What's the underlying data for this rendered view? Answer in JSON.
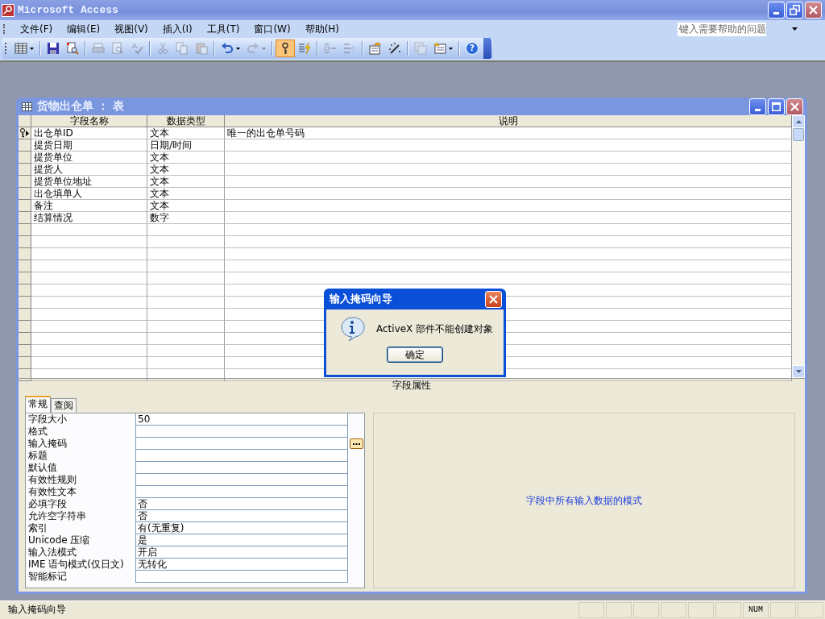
{
  "app": {
    "title": "Microsoft Access"
  },
  "menu": [
    {
      "label": "文件(F)"
    },
    {
      "label": "编辑(E)"
    },
    {
      "label": "视图(V)"
    },
    {
      "label": "插入(I)"
    },
    {
      "label": "工具(T)"
    },
    {
      "label": "窗口(W)"
    },
    {
      "label": "帮助(H)"
    }
  ],
  "help_box": {
    "placeholder": "键入需要帮助的问题"
  },
  "toolbar": [
    {
      "kind": "view",
      "disabled": false,
      "selected": false,
      "dropdown": true
    },
    {
      "kind": "separator"
    },
    {
      "kind": "save",
      "disabled": false,
      "selected": false,
      "dropdown": false
    },
    {
      "kind": "file-search",
      "disabled": false,
      "selected": false,
      "dropdown": false
    },
    {
      "kind": "separator"
    },
    {
      "kind": "print",
      "disabled": true,
      "selected": false,
      "dropdown": false
    },
    {
      "kind": "preview",
      "disabled": true,
      "selected": false,
      "dropdown": false
    },
    {
      "kind": "spelling",
      "disabled": true,
      "selected": false,
      "dropdown": false
    },
    {
      "kind": "separator"
    },
    {
      "kind": "cut",
      "disabled": true,
      "selected": false,
      "dropdown": false
    },
    {
      "kind": "copy",
      "disabled": true,
      "selected": false,
      "dropdown": false
    },
    {
      "kind": "paste",
      "disabled": true,
      "selected": false,
      "dropdown": false
    },
    {
      "kind": "separator"
    },
    {
      "kind": "undo",
      "disabled": false,
      "selected": false,
      "dropdown": true
    },
    {
      "kind": "redo",
      "disabled": true,
      "selected": false,
      "dropdown": true
    },
    {
      "kind": "separator"
    },
    {
      "kind": "key",
      "disabled": false,
      "selected": true,
      "dropdown": false
    },
    {
      "kind": "indexes",
      "disabled": false,
      "selected": false,
      "dropdown": false
    },
    {
      "kind": "separator"
    },
    {
      "kind": "insert-rows",
      "disabled": true,
      "selected": false,
      "dropdown": false
    },
    {
      "kind": "delete-rows",
      "disabled": true,
      "selected": false,
      "dropdown": false
    },
    {
      "kind": "separator"
    },
    {
      "kind": "properties",
      "disabled": false,
      "selected": false,
      "dropdown": false
    },
    {
      "kind": "build",
      "disabled": false,
      "selected": false,
      "dropdown": false
    },
    {
      "kind": "separator"
    },
    {
      "kind": "database-window",
      "disabled": true,
      "selected": false,
      "dropdown": false
    },
    {
      "kind": "new-object",
      "disabled": false,
      "selected": false,
      "dropdown": true
    },
    {
      "kind": "separator"
    },
    {
      "kind": "help",
      "label": "?",
      "disabled": false,
      "selected": false,
      "dropdown": false
    }
  ],
  "table_window": {
    "title": "货物出仓单 ： 表",
    "columns": [
      "字段名称",
      "数据类型",
      "说明"
    ],
    "rows": [
      {
        "name": "出仓单ID",
        "type": "文本",
        "description": "唯一的出仓单号码",
        "primary_key": true,
        "current": true
      },
      {
        "name": "提货日期",
        "type": "日期/时间",
        "primary_key": false,
        "current": false
      },
      {
        "name": "提货单位",
        "type": "文本",
        "primary_key": false,
        "current": false
      },
      {
        "name": "提货人",
        "type": "文本",
        "primary_key": false,
        "current": false
      },
      {
        "name": "提货单位地址",
        "type": "文本",
        "primary_key": false,
        "current": false
      },
      {
        "name": "出仓填单人",
        "type": "文本",
        "primary_key": false,
        "current": false
      },
      {
        "name": "备注",
        "type": "文本",
        "primary_key": false,
        "current": false
      },
      {
        "name": "结算情况",
        "type": "数字",
        "primary_key": false,
        "current": false
      }
    ],
    "properties_heading": "字段属性",
    "tabs": [
      {
        "label": "常规",
        "selected": true
      },
      {
        "label": "查阅",
        "selected": false
      }
    ],
    "properties": [
      {
        "label": "字段大小",
        "value": "50",
        "builder": false
      },
      {
        "label": "格式",
        "builder": false
      },
      {
        "label": "输入掩码",
        "builder": true
      },
      {
        "label": "标题",
        "builder": false
      },
      {
        "label": "默认值",
        "builder": false
      },
      {
        "label": "有效性规则",
        "builder": false
      },
      {
        "label": "有效性文本",
        "builder": false
      },
      {
        "label": "必填字段",
        "value": "否",
        "builder": false
      },
      {
        "label": "允许空字符串",
        "value": "否",
        "builder": false
      },
      {
        "label": "索引",
        "value": "有(无重复)",
        "builder": false
      },
      {
        "label": "Unicode 压缩",
        "value": "是",
        "builder": false
      },
      {
        "label": "输入法模式",
        "value": "开启",
        "builder": false
      },
      {
        "label": "IME 语句模式(仅日文)",
        "value": "无转化",
        "builder": false
      },
      {
        "label": "智能标记",
        "builder": false
      }
    ],
    "property_help": "字段中所有输入数据的模式"
  },
  "dialog": {
    "title": "输入掩码向导",
    "message": "ActiveX 部件不能创建对象",
    "button": "确定"
  },
  "status_bar": {
    "text": "输入掩码向导",
    "num_indicator": "NUM"
  }
}
